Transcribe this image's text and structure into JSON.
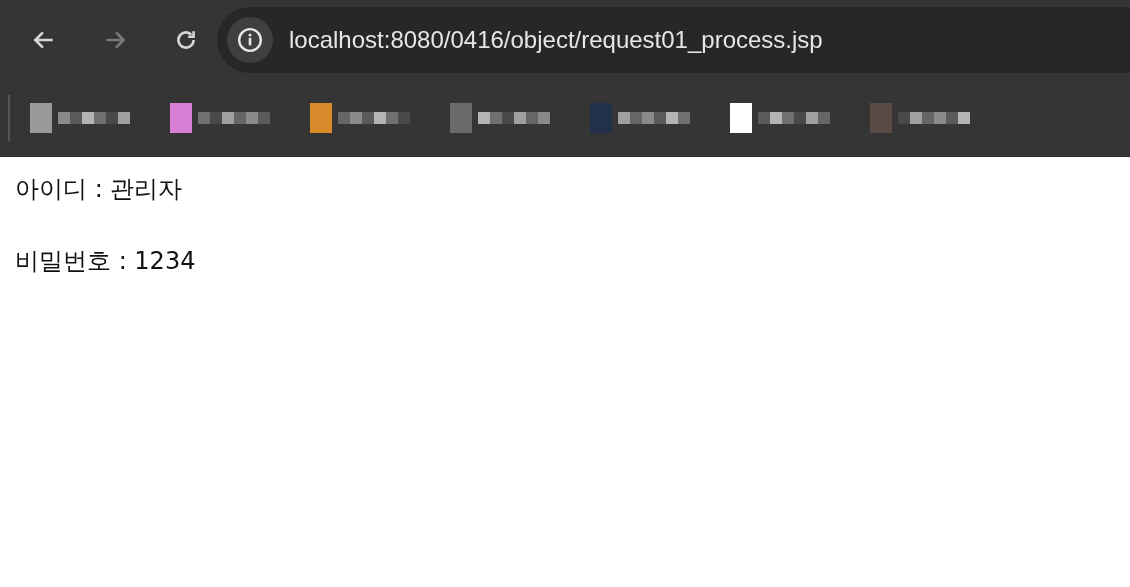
{
  "toolbar": {
    "buttons": [
      {
        "kind": "back",
        "disabled": false
      },
      {
        "kind": "forward",
        "disabled": true
      },
      {
        "kind": "reload",
        "disabled": false
      }
    ],
    "address": "localhost:8080/0416/object/request01_process.jsp"
  },
  "bookmarks": [
    {
      "color": "#9a9a9a"
    },
    {
      "color": "#d77fd7"
    },
    {
      "color": "#d98a2a"
    },
    {
      "color": "#6a6a6a"
    },
    {
      "color": "#22314a"
    },
    {
      "color": "#ffffff"
    },
    {
      "color": "#5a4a44"
    }
  ],
  "content": {
    "lines": [
      "아이디 : 관리자",
      "비밀번호 : 1234"
    ]
  }
}
